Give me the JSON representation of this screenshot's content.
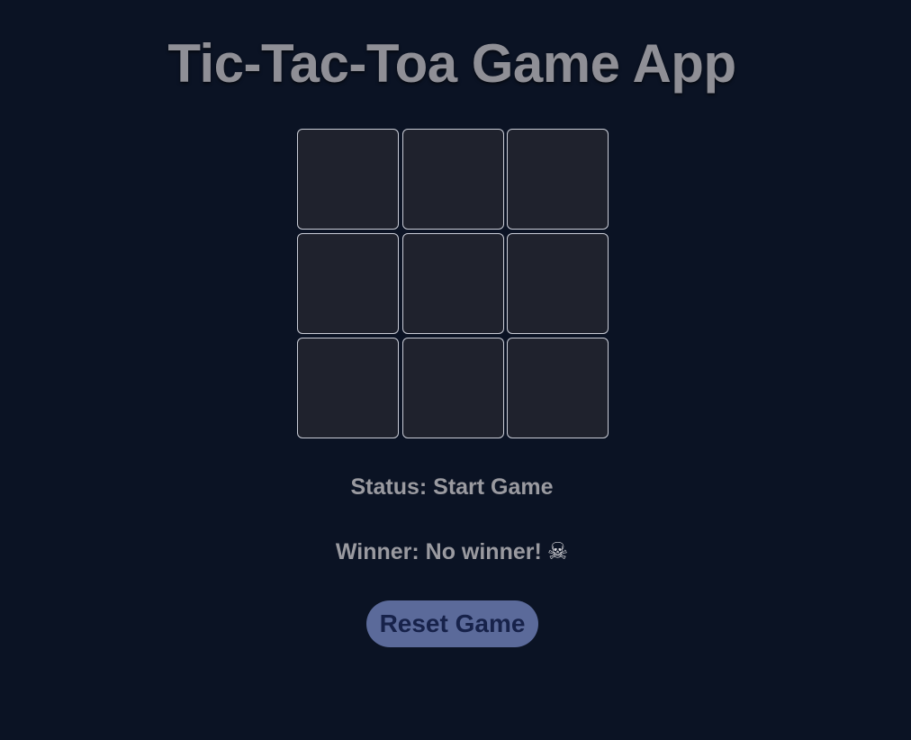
{
  "title": "Tic-Tac-Toa Game App",
  "board": {
    "cells": [
      "",
      "",
      "",
      "",
      "",
      "",
      "",
      "",
      ""
    ]
  },
  "status": {
    "text": "Status: Start Game"
  },
  "winner": {
    "text": "Winner: No winner!",
    "icon": "skull-crossbones-icon",
    "icon_glyph": "☠"
  },
  "reset_button": {
    "label": "Reset Game"
  },
  "colors": {
    "background": "#0b1324",
    "cell": "#1f222d",
    "cell_border": "#c9ccd6",
    "text": "#9a9aa0",
    "button": "#5b6a9a",
    "button_text": "#17224a"
  }
}
